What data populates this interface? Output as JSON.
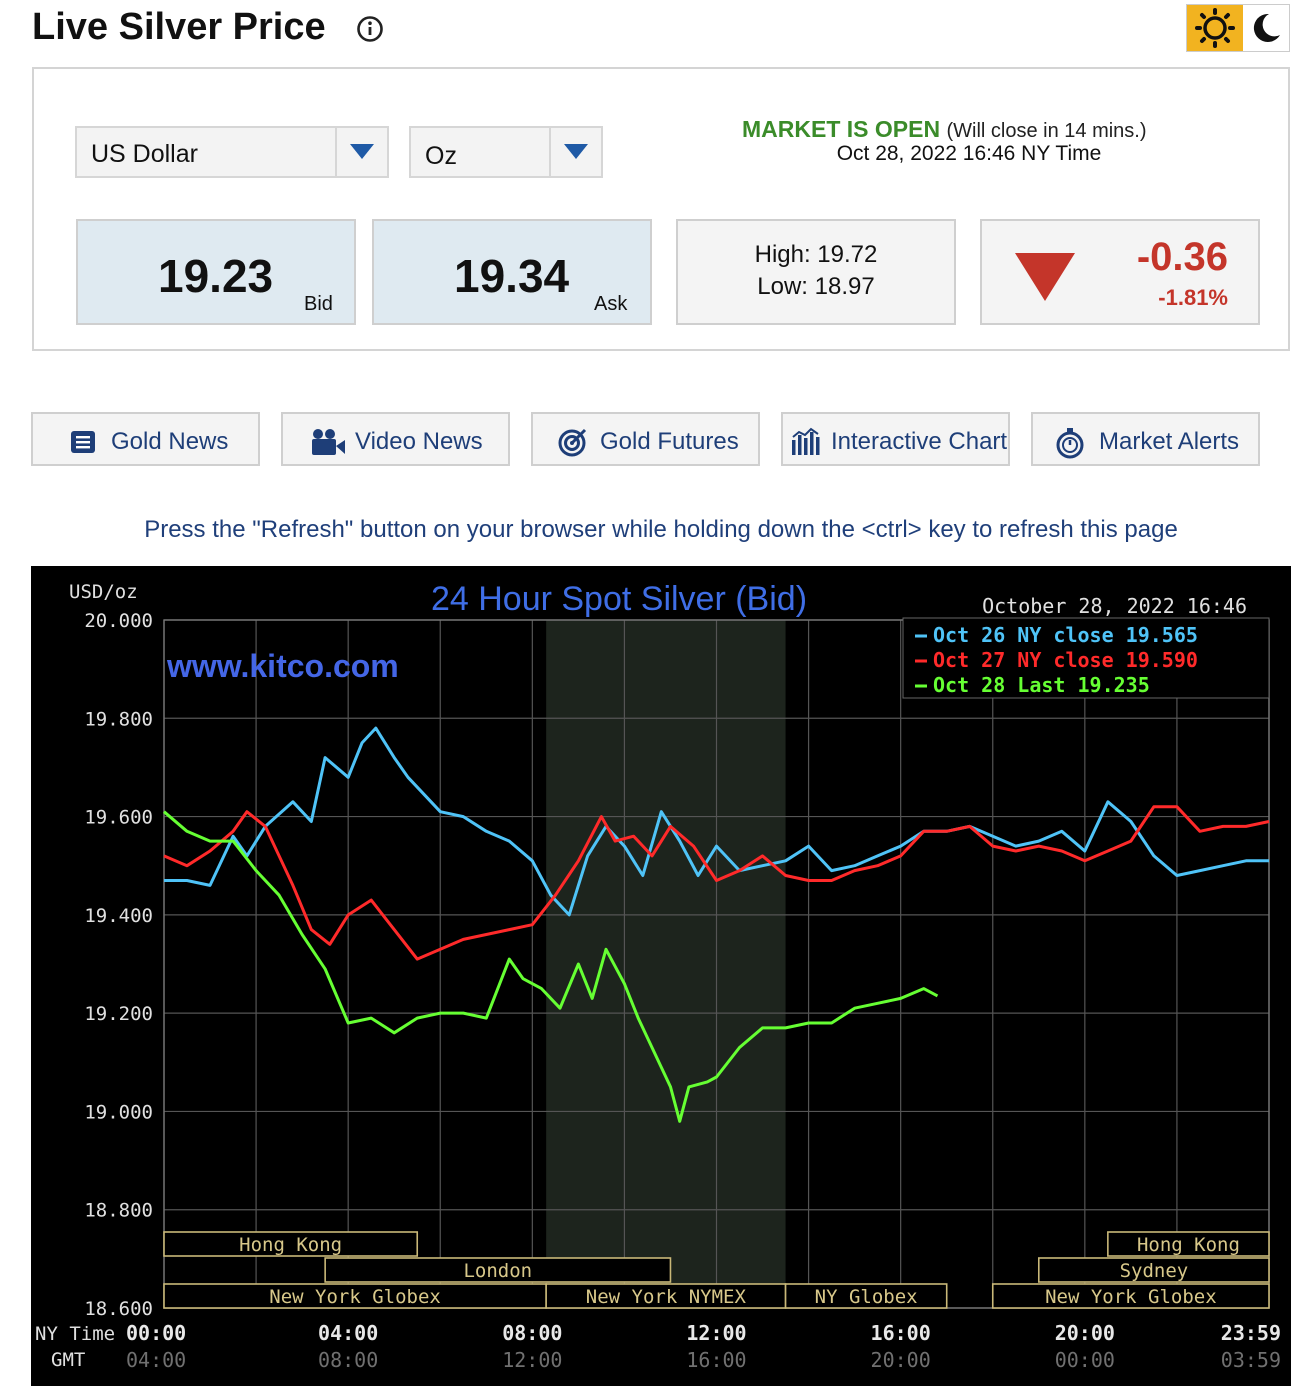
{
  "header": {
    "title": "Live Silver Price",
    "info_icon": "info-circle-icon",
    "theme_light_icon": "sun-icon",
    "theme_dark_icon": "moon-icon",
    "accent_color": "#f2b320"
  },
  "selectors": {
    "currency": "US Dollar",
    "unit": "Oz"
  },
  "market": {
    "status": "MARKET IS OPEN",
    "close_note": "(Will close in 14 mins.)",
    "timestamp": "Oct 28, 2022 16:46 NY Time",
    "status_color": "#3b8c2a"
  },
  "quote": {
    "bid": "19.23",
    "bid_label": "Bid",
    "ask": "19.34",
    "ask_label": "Ask",
    "high": "High: 19.72",
    "low": "Low: 18.97",
    "change": "-0.36",
    "change_pct": "-1.81%",
    "direction": "down",
    "change_color": "#c4352a"
  },
  "nav_buttons": [
    {
      "label": "Gold News",
      "icon": "newspaper-icon"
    },
    {
      "label": "Video News",
      "icon": "video-camera-icon"
    },
    {
      "label": "Gold Futures",
      "icon": "target-icon"
    },
    {
      "label": "Interactive Chart",
      "icon": "bar-chart-icon"
    },
    {
      "label": "Market Alerts",
      "icon": "stopwatch-icon"
    }
  ],
  "refresh_note": "Press the \"Refresh\" button on your browser while holding down the <ctrl> key to refresh this page",
  "chart_data": {
    "type": "line",
    "title": "24 Hour Spot Silver (Bid)",
    "watermark": "www.kitco.com",
    "ylabel": "USD/oz",
    "date_label": "October 28, 2022 16:46",
    "ylim": [
      18.6,
      20.0
    ],
    "y_ticks": [
      "20.000",
      "19.800",
      "19.600",
      "19.400",
      "19.200",
      "19.000",
      "18.800",
      "18.600"
    ],
    "x_tick_labels_ny": [
      "00:00",
      "04:00",
      "08:00",
      "12:00",
      "16:00",
      "20:00",
      "23:59"
    ],
    "x_tick_labels_gmt": [
      "04:00",
      "08:00",
      "12:00",
      "16:00",
      "20:00",
      "00:00",
      "03:59"
    ],
    "x_row_labels": [
      "NY Time",
      "GMT"
    ],
    "legend_placement": "top-right",
    "sessions": [
      {
        "name": "Hong Kong",
        "start": 0.0,
        "end": 5.5
      },
      {
        "name": "London",
        "start": 3.5,
        "end": 11.0
      },
      {
        "name": "New York Globex",
        "start": 0.0,
        "end": 8.3
      },
      {
        "name": "New York NYMEX",
        "start": 8.3,
        "end": 13.5
      },
      {
        "name": "NY Globex",
        "start": 13.5,
        "end": 17.0
      },
      {
        "name": "Hong Kong",
        "start": 20.5,
        "end": 24.0
      },
      {
        "name": "Sydney",
        "start": 19.0,
        "end": 24.0
      },
      {
        "name": "New York Globex",
        "start": 18.0,
        "end": 24.0
      }
    ],
    "session_labels": {
      "hong_kong": "Hong Kong",
      "london": "London",
      "sydney": "Sydney",
      "ny_globex_full": "New York Globex",
      "ny_nymex": "New York NYMEX",
      "ny_globex": "NY Globex"
    },
    "shaded_region": {
      "start": 8.3,
      "end": 13.5
    },
    "series": [
      {
        "name": "Oct 26 NY close 19.565",
        "color": "#4fc3f7",
        "x": [
          0,
          0.5,
          1,
          1.5,
          1.8,
          2.2,
          2.8,
          3.2,
          3.5,
          4.0,
          4.3,
          4.6,
          5.0,
          5.3,
          6.0,
          6.5,
          7.0,
          7.5,
          8.0,
          8.4,
          8.8,
          9.2,
          9.6,
          10.0,
          10.4,
          10.8,
          11.2,
          11.6,
          12.0,
          12.5,
          13.0,
          13.5,
          14.0,
          14.5,
          15.0,
          15.5,
          16.0,
          16.5,
          17.0,
          17.5,
          18.0,
          18.5,
          19.0,
          19.5,
          20.0,
          20.5,
          21.0,
          21.5,
          22.0,
          22.5,
          23.0,
          23.5,
          24.0
        ],
        "values": [
          19.47,
          19.47,
          19.46,
          19.56,
          19.52,
          19.58,
          19.63,
          19.59,
          19.72,
          19.68,
          19.75,
          19.78,
          19.72,
          19.68,
          19.61,
          19.6,
          19.57,
          19.55,
          19.51,
          19.44,
          19.4,
          19.52,
          19.58,
          19.54,
          19.48,
          19.61,
          19.55,
          19.48,
          19.54,
          19.49,
          19.5,
          19.51,
          19.54,
          19.49,
          19.5,
          19.52,
          19.54,
          19.57,
          19.57,
          19.58,
          19.56,
          19.54,
          19.55,
          19.57,
          19.53,
          19.63,
          19.59,
          19.52,
          19.48,
          19.49,
          19.5,
          19.51,
          19.51
        ]
      },
      {
        "name": "Oct 27 NY close 19.590",
        "color": "#ff2a2a",
        "x": [
          0,
          0.5,
          1,
          1.5,
          1.8,
          2.2,
          2.8,
          3.2,
          3.6,
          4.0,
          4.5,
          5.0,
          5.5,
          6.0,
          6.5,
          7.0,
          7.5,
          8.0,
          8.5,
          9.0,
          9.5,
          9.8,
          10.2,
          10.6,
          11.0,
          11.5,
          12.0,
          12.5,
          13.0,
          13.5,
          14.0,
          14.5,
          15.0,
          15.5,
          16.0,
          16.5,
          17.0,
          17.5,
          18.0,
          18.5,
          19.0,
          19.5,
          20.0,
          20.5,
          21.0,
          21.5,
          22.0,
          22.5,
          23.0,
          23.5,
          24.0
        ],
        "values": [
          19.52,
          19.5,
          19.53,
          19.57,
          19.61,
          19.58,
          19.46,
          19.37,
          19.34,
          19.4,
          19.43,
          19.37,
          19.31,
          19.33,
          19.35,
          19.36,
          19.37,
          19.38,
          19.44,
          19.51,
          19.6,
          19.55,
          19.56,
          19.52,
          19.58,
          19.54,
          19.47,
          19.49,
          19.52,
          19.48,
          19.47,
          19.47,
          19.49,
          19.5,
          19.52,
          19.57,
          19.57,
          19.58,
          19.54,
          19.53,
          19.54,
          19.53,
          19.51,
          19.53,
          19.55,
          19.62,
          19.62,
          19.57,
          19.58,
          19.58,
          19.59
        ]
      },
      {
        "name": "Oct 28 Last 19.235",
        "color": "#66ff33",
        "x": [
          0,
          0.5,
          1,
          1.5,
          2.0,
          2.5,
          3.0,
          3.5,
          4.0,
          4.5,
          5.0,
          5.5,
          6.0,
          6.5,
          7.0,
          7.5,
          7.8,
          8.2,
          8.6,
          9.0,
          9.3,
          9.6,
          10.0,
          10.3,
          10.6,
          11.0,
          11.2,
          11.4,
          11.8,
          12.0,
          12.5,
          13.0,
          13.5,
          14.0,
          14.5,
          15.0,
          15.5,
          16.0,
          16.5,
          16.8
        ],
        "values": [
          19.61,
          19.57,
          19.55,
          19.55,
          19.49,
          19.44,
          19.36,
          19.29,
          19.18,
          19.19,
          19.16,
          19.19,
          19.2,
          19.2,
          19.19,
          19.31,
          19.27,
          19.25,
          19.21,
          19.3,
          19.23,
          19.33,
          19.26,
          19.19,
          19.13,
          19.05,
          18.98,
          19.05,
          19.06,
          19.07,
          19.13,
          19.17,
          19.17,
          19.18,
          19.18,
          19.21,
          19.22,
          19.23,
          19.25,
          19.235
        ]
      }
    ]
  }
}
